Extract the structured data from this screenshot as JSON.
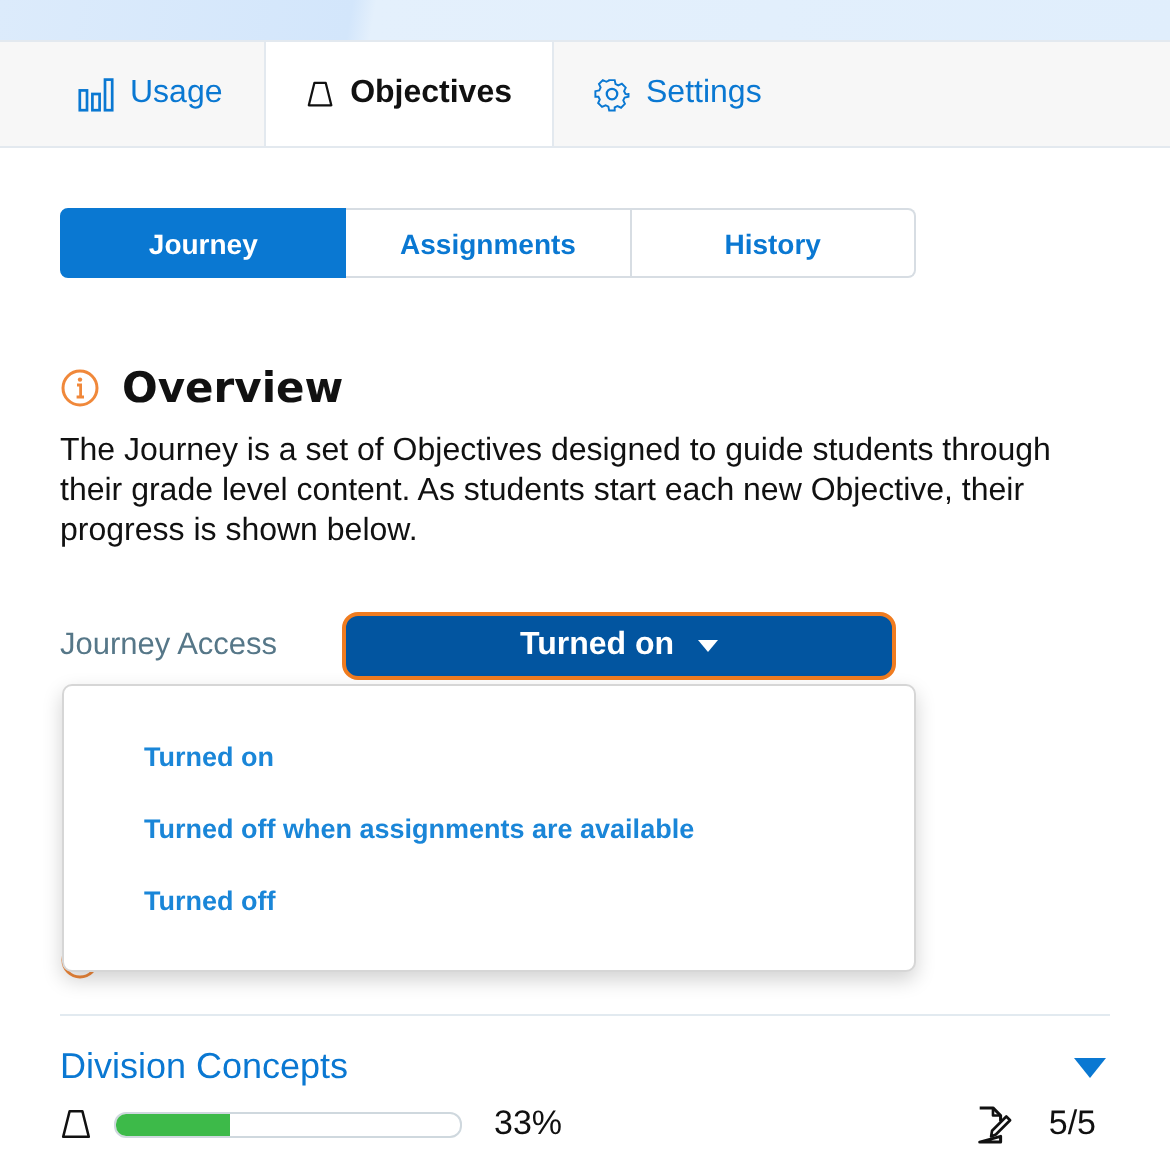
{
  "tabs": [
    {
      "label": "Usage",
      "kind": "usage",
      "selected": false
    },
    {
      "label": "Objectives",
      "kind": "objectives",
      "selected": true
    },
    {
      "label": "Settings",
      "kind": "settings",
      "selected": false
    }
  ],
  "subtabs": [
    {
      "label": "Journey",
      "selected": true
    },
    {
      "label": "Assignments",
      "selected": false
    },
    {
      "label": "History",
      "selected": false
    }
  ],
  "overview": {
    "title": "Overview",
    "text": "The Journey is a set of Objectives designed to guide students through their grade level content. As students start each new Objective, their progress is shown below."
  },
  "access": {
    "label": "Journey Access",
    "value": "Turned on",
    "expanded": true,
    "options": [
      "Turned on",
      "Turned off when assignments are available",
      "Turned off"
    ]
  },
  "objective": {
    "title": "Division Concepts",
    "level": 0.33,
    "percent": "33%",
    "score": "5/5"
  }
}
